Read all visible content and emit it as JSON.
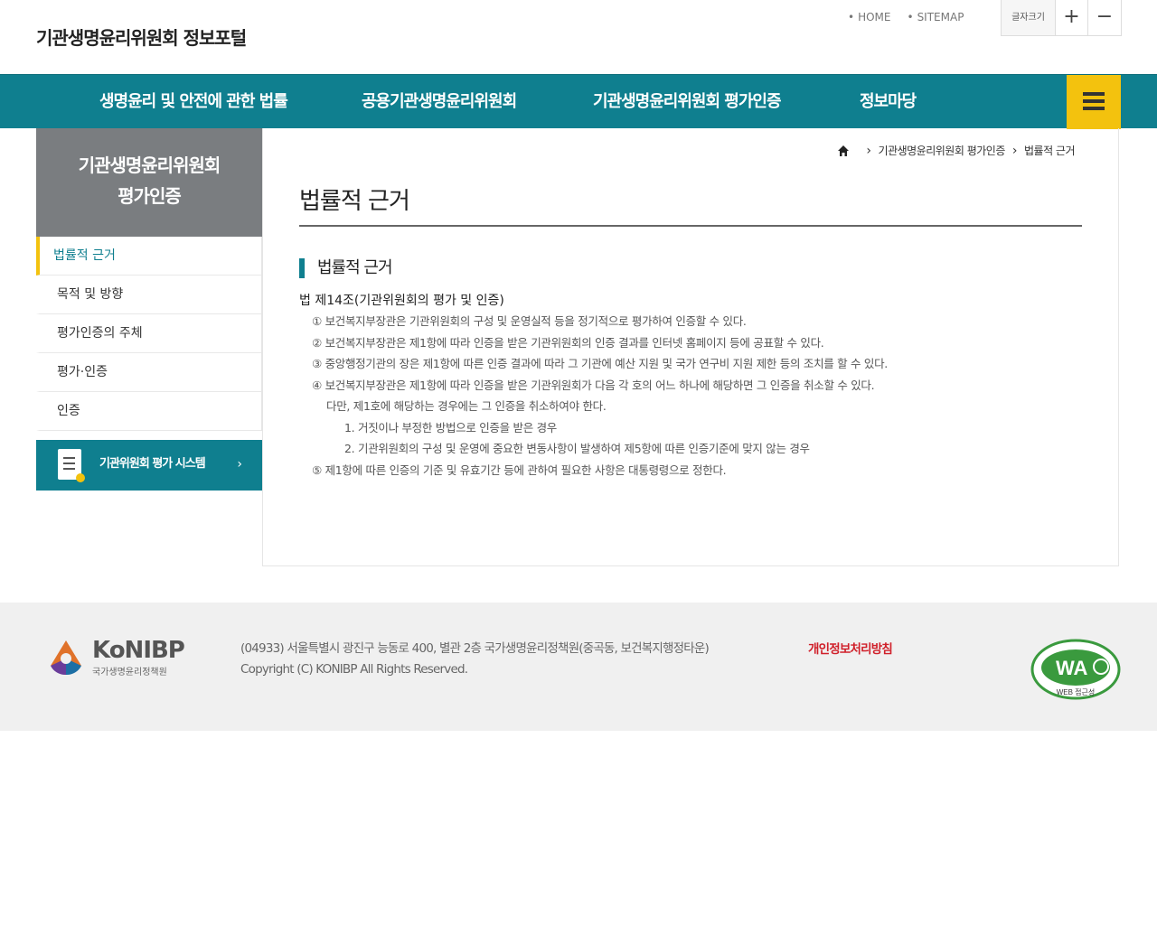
{
  "header": {
    "site_title": "기관생명윤리위원회 정보포털",
    "util": {
      "home": "HOME",
      "sitemap": "SITEMAP"
    },
    "fontsize": {
      "label": "글자크기",
      "plus": "+",
      "minus": "−"
    }
  },
  "nav": {
    "items": [
      {
        "label": "생명윤리 및 안전에 관한 법률"
      },
      {
        "label": "공용기관생명윤리위원회"
      },
      {
        "label": "기관생명윤리위원회 평가인증"
      },
      {
        "label": "정보마당"
      }
    ],
    "menu_icon": "hamburger-icon"
  },
  "sidebar": {
    "title_line1": "기관생명윤리위원회",
    "title_line2": "평가인증",
    "items": [
      {
        "label": "법률적 근거",
        "active": true
      },
      {
        "label": "목적 및 방향",
        "active": false
      },
      {
        "label": "평가인증의 주체",
        "active": false
      },
      {
        "label": "평가·인증",
        "active": false
      },
      {
        "label": "인증",
        "active": false
      }
    ],
    "banner": {
      "label": "기관위원회 평가 시스템",
      "arrow": "›",
      "icon": "document-icon"
    }
  },
  "content": {
    "breadcrumb": [
      "기관생명윤리위원회 평가인증",
      "법률적 근거"
    ],
    "page_title": "법률적 근거",
    "section_title": "법률적 근거",
    "law_title": "법 제14조(기관위원회의 평가 및 인증)",
    "lines": [
      {
        "text": "① 보건복지부장관은 기관위원회의 구성 및 운영실적 등을 정기적으로 평가하여 인증할 수 있다.",
        "indent": 0
      },
      {
        "text": "② 보건복지부장관은 제1항에 따라 인증을 받은 기관위원회의 인증 결과를 인터넷 홈페이지 등에 공표할 수 있다.",
        "indent": 0
      },
      {
        "text": "③ 중앙행정기관의 장은 제1항에 따른 인증 결과에 따라 그 기관에 예산 지원 및 국가 연구비 지원 제한 등의 조치를 할 수 있다.",
        "indent": 0
      },
      {
        "text": "④ 보건복지부장관은 제1항에 따라 인증을 받은 기관위원회가 다음 각 호의 어느 하나에 해당하면 그 인증을 취소할 수 있다.",
        "indent": 0
      },
      {
        "text": "다만, 제1호에 해당하는 경우에는 그 인증을 취소하여야 한다.",
        "indent": 1
      },
      {
        "text": "1. 거짓이나 부정한 방법으로 인증을 받은 경우",
        "indent": 2
      },
      {
        "text": "2. 기관위원회의 구성 및 운영에 중요한 변동사항이 발생하여 제5항에 따른 인증기준에 맞지 않는 경우",
        "indent": 2
      },
      {
        "text": "⑤ 제1항에 따른 인증의 기준 및 유효기간 등에 관하여 필요한 사항은 대통령령으로 정한다.",
        "indent": 0
      }
    ]
  },
  "footer": {
    "logo_text": "KoNIBP",
    "logo_sub": "국가생명윤리정책원",
    "address": "(04933) 서울특별시 광진구 능동로 400, 별관 2층 국가생명윤리정책원(중곡동, 보건복지행정타운)",
    "copyright": "Copyright (C) KONIBP All Rights Reserved.",
    "privacy": "개인정보처리방침",
    "wa_text": "WA",
    "wa_sub": "WEB 접근성"
  },
  "colors": {
    "primary": "#0f7f8f",
    "accent": "#f3c20e",
    "sidebar_head": "#7a7d80",
    "privacy": "#d0202a"
  }
}
